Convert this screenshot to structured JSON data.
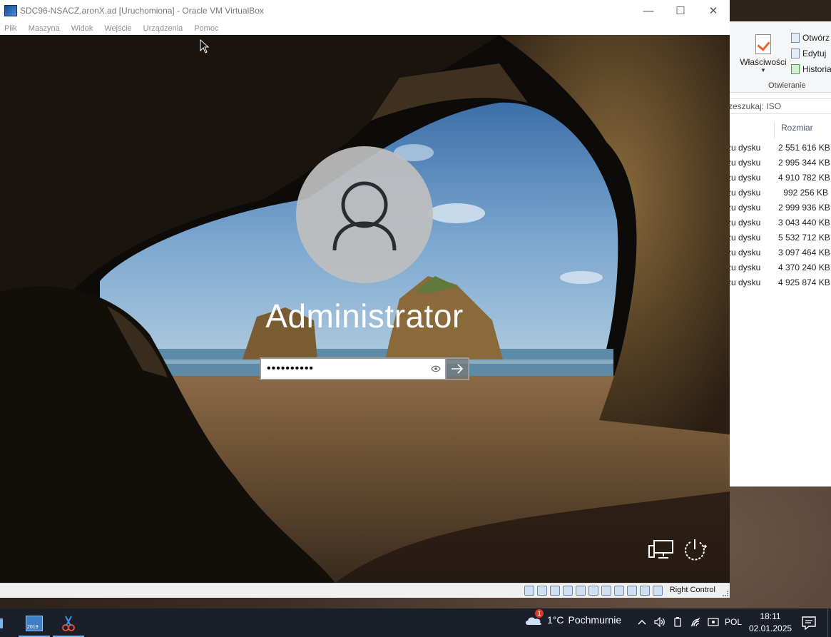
{
  "window": {
    "title": "SDC96-NSACZ.aronX.ad [Uruchomiona] - Oracle VM VirtualBox",
    "minimize_glyph": "—",
    "maximize_glyph": "☐",
    "close_glyph": "✕"
  },
  "menu": [
    "Plik",
    "Maszyna",
    "Widok",
    "Wejście",
    "Urządzenia",
    "Pomoc"
  ],
  "login": {
    "username": "Administrator",
    "password_mask": "••••••••••",
    "reveal_icon": "eye-icon",
    "submit_icon": "arrow-right-icon",
    "network_icon": "network-icon",
    "power_icon": "power-icon"
  },
  "statusbar": {
    "host_key": "Right Control",
    "indicator_icons": [
      "hard-disk-icon",
      "optical-drive-icon",
      "audio-icon",
      "network-adapter-icon",
      "usb-icon",
      "shared-folder-icon",
      "display-icon",
      "video-capture-icon",
      "cpu-icon",
      "mouse-integration-icon",
      "arrow-down-icon"
    ]
  },
  "explorer": {
    "ribbon": {
      "properties_label": "Właściwości",
      "open_label": "Otwórz",
      "edit_label": "Edytuj",
      "history_label": "Historia",
      "group_label": "Otwieranie"
    },
    "search_placeholder": "zeszukaj: ISO",
    "column_size": "Rozmiar",
    "rows": [
      {
        "type": "zu dysku",
        "size": "2 551 616 KB"
      },
      {
        "type": "zu dysku",
        "size": "2 995 344 KB"
      },
      {
        "type": "zu dysku",
        "size": "4 910 782 KB"
      },
      {
        "type": "zu dysku",
        "size": "992 256 KB"
      },
      {
        "type": "zu dysku",
        "size": "2 999 936 KB"
      },
      {
        "type": "zu dysku",
        "size": "3 043 440 KB"
      },
      {
        "type": "zu dysku",
        "size": "5 532 712 KB"
      },
      {
        "type": "zu dysku",
        "size": "3 097 464 KB"
      },
      {
        "type": "zu dysku",
        "size": "4 370 240 KB"
      },
      {
        "type": "zu dysku",
        "size": "4 925 874 KB"
      }
    ]
  },
  "taskbar": {
    "apps": [
      {
        "name": "server-manager-icon",
        "label": "2019"
      },
      {
        "name": "snipping-tool-icon"
      }
    ],
    "weather": {
      "temp": "1°C",
      "condition": "Pochmurnie",
      "badge": "1"
    },
    "tray_icons": [
      "chevron-up-icon",
      "volume-icon",
      "battery-icon",
      "wifi-icon",
      "defender-icon"
    ],
    "language": "POL",
    "time": "18:11",
    "date": "02.01.2025"
  },
  "colors": {
    "accent": "#7ab3e8",
    "taskbar_bg": "#1a1f2a"
  }
}
